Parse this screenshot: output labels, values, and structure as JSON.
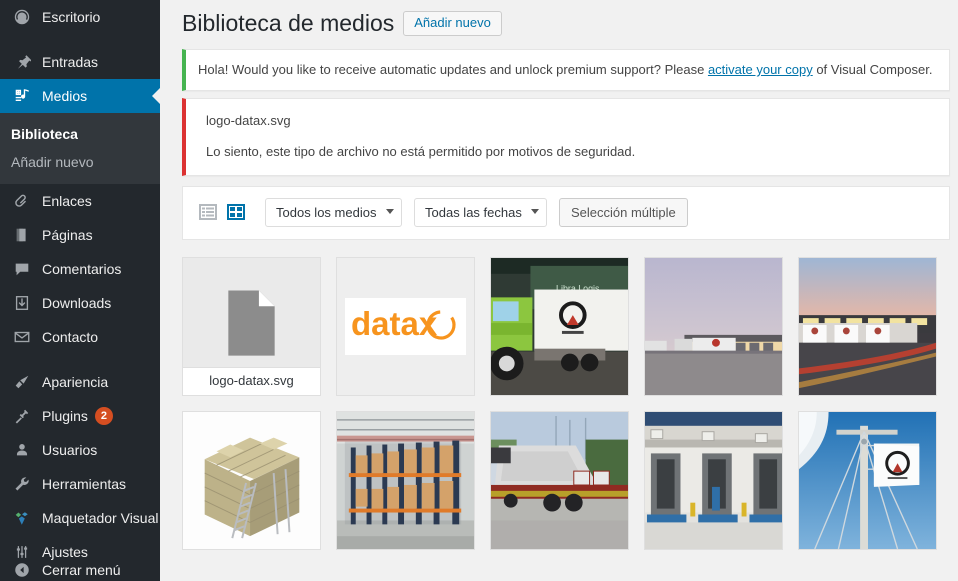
{
  "sidebar": {
    "items": [
      {
        "label": "Escritorio",
        "icon": "dashboard-icon",
        "current": false,
        "separator": false
      },
      {
        "label": "Entradas",
        "icon": "pin-icon",
        "current": false,
        "separator": true
      },
      {
        "label": "Medios",
        "icon": "media-icon",
        "current": true,
        "separator": false
      },
      {
        "label": "Enlaces",
        "icon": "link-icon",
        "current": false,
        "separator": true
      },
      {
        "label": "Páginas",
        "icon": "pages-icon",
        "current": false,
        "separator": false
      },
      {
        "label": "Comentarios",
        "icon": "comment-icon",
        "current": false,
        "separator": false
      },
      {
        "label": "Downloads",
        "icon": "download-icon",
        "current": false,
        "separator": false
      },
      {
        "label": "Contacto",
        "icon": "envelope-icon",
        "current": false,
        "separator": false
      },
      {
        "label": "Apariencia",
        "icon": "brush-icon",
        "current": false,
        "separator": true
      },
      {
        "label": "Plugins",
        "icon": "plug-icon",
        "current": false,
        "separator": false,
        "badge": "2"
      },
      {
        "label": "Usuarios",
        "icon": "user-icon",
        "current": false,
        "separator": false
      },
      {
        "label": "Herramientas",
        "icon": "wrench-icon",
        "current": false,
        "separator": false
      },
      {
        "label": "Maquetador Visual",
        "icon": "visual-composer-icon",
        "current": false,
        "separator": false
      },
      {
        "label": "Ajustes",
        "icon": "settings-icon",
        "current": false,
        "separator": false
      },
      {
        "label": "Cerrar menú",
        "icon": "collapse-icon",
        "current": false,
        "separator": false
      }
    ],
    "submenu": [
      {
        "label": "Biblioteca",
        "active": true
      },
      {
        "label": "Añadir nuevo",
        "active": false
      }
    ],
    "accent_color": "#0073aa",
    "background_color": "#23282d",
    "badge_color": "#d54e21"
  },
  "header": {
    "title": "Biblioteca de medios",
    "add_new_label": "Añadir nuevo"
  },
  "notices": {
    "update": {
      "text_before": "Hola! Would you like to receive automatic updates and unlock premium support? Please ",
      "link": "activate your copy",
      "text_after": " of Visual Composer.",
      "accent_color": "#46b450"
    },
    "error": {
      "file": "logo-datax.svg",
      "message": "Lo siento, este tipo de archivo no está permitido por motivos de seguridad.",
      "accent_color": "#dc3232"
    }
  },
  "toolbar": {
    "list_view_icon": "list-view-icon",
    "grid_view_icon": "grid-view-icon",
    "media_filter": "Todos los medios",
    "date_filter": "Todas las fechas",
    "bulk_select_label": "Selección múltiple",
    "active_view": "grid"
  },
  "media": {
    "items": [
      {
        "name": "logo-datax.svg",
        "type": "file",
        "show_label": true
      },
      {
        "name": "datax-logo",
        "type": "logo",
        "logo_text": "datax",
        "logo_color": "#F7941E",
        "show_label": false
      },
      {
        "name": "green-truck-trailer",
        "type": "image",
        "show_label": false
      },
      {
        "name": "dock-dusk-trucks",
        "type": "image",
        "show_label": false
      },
      {
        "name": "dock-sunset-fleet",
        "type": "image",
        "show_label": false
      },
      {
        "name": "cardboard-box-cube",
        "type": "image",
        "show_label": false
      },
      {
        "name": "warehouse-racking",
        "type": "image",
        "show_label": false
      },
      {
        "name": "boat-transport-truck",
        "type": "image",
        "show_label": false
      },
      {
        "name": "loading-docks-building",
        "type": "image",
        "show_label": false
      },
      {
        "name": "flag-on-mast",
        "type": "image",
        "show_label": false
      }
    ]
  }
}
